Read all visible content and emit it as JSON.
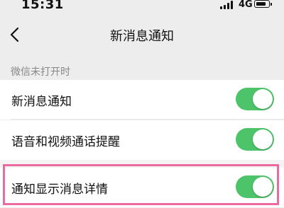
{
  "status_bar": {
    "time": "15:31",
    "network": "4G",
    "battery_level": 0.85
  },
  "nav": {
    "title": "新消息通知",
    "back_icon": "chevron-left-icon"
  },
  "section": {
    "header": "微信未打开时"
  },
  "settings": [
    {
      "label": "新消息通知",
      "enabled": true
    },
    {
      "label": "语音和视频通话提醒",
      "enabled": true
    },
    {
      "label": "通知显示消息详情",
      "enabled": true,
      "highlighted": true
    }
  ],
  "colors": {
    "toggle_on": "#4ec46a",
    "highlight": "#ec6a9f",
    "background": "#ededed"
  }
}
